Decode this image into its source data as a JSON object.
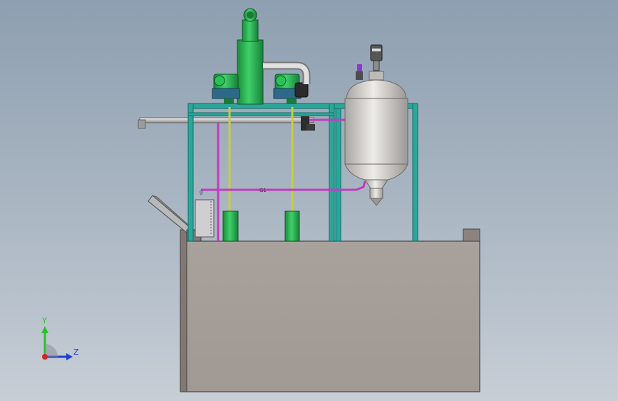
{
  "scene": {
    "colors": {
      "frame": "#2aa79a",
      "equipment_green": "#29b14f",
      "pipe_magenta": "#c13bc0",
      "pipe_yellow": "#c7cf3a",
      "tank_steel": "#c9c6c2",
      "base_box": "#a29b96"
    },
    "pipe_labels": {
      "left_tag": "g",
      "mid_tag": "G1"
    }
  },
  "triad": {
    "y_label": "Y",
    "z_label": "Z",
    "colors": {
      "y": "#2bbf2b",
      "z": "#1d3fd6",
      "origin": "#d62424"
    }
  }
}
